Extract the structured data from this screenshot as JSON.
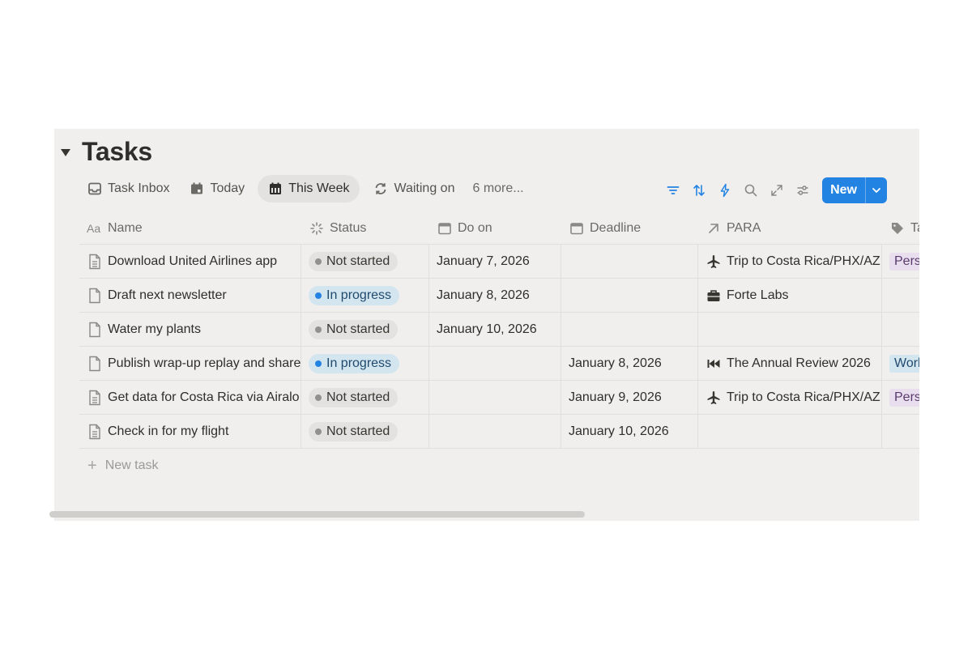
{
  "header": {
    "title": "Tasks"
  },
  "views": [
    {
      "label": "Task Inbox",
      "icon": "inbox-icon",
      "active": false
    },
    {
      "label": "Today",
      "icon": "calendar-day-icon",
      "active": false
    },
    {
      "label": "This Week",
      "icon": "calendar-week-icon",
      "active": true
    },
    {
      "label": "Waiting on",
      "icon": "refresh-icon",
      "active": false
    }
  ],
  "more_views": "6 more...",
  "toolbar": {
    "new_label": "New",
    "accent": "#2383e2"
  },
  "columns": {
    "name": "Name",
    "status": "Status",
    "doon": "Do on",
    "deadline": "Deadline",
    "para": "PARA",
    "tags": "Tags"
  },
  "rows": [
    {
      "name": "Download United Airlines app",
      "status": "Not started",
      "doon": "January 7, 2026",
      "deadline": "",
      "para": "Trip to Costa Rica/PHX/AZ",
      "para_icon": "airplane-icon",
      "tag": "Personal",
      "tag_kind": "personal"
    },
    {
      "name": "Draft next newsletter",
      "status": "In progress",
      "doon": "January 8, 2026",
      "deadline": "",
      "para": "Forte Labs",
      "para_icon": "briefcase-icon",
      "tag": "",
      "tag_kind": ""
    },
    {
      "name": "Water my plants",
      "status": "Not started",
      "doon": "January 10, 2026",
      "deadline": "",
      "para": "",
      "para_icon": "",
      "tag": "",
      "tag_kind": ""
    },
    {
      "name": "Publish wrap-up replay and share",
      "status": "In progress",
      "doon": "",
      "deadline": "January 8, 2026",
      "para": "The Annual Review 2026",
      "para_icon": "rewind-icon",
      "tag": "Work",
      "tag_kind": "work"
    },
    {
      "name": "Get data for Costa Rica via Airalo",
      "status": "Not started",
      "doon": "",
      "deadline": "January 9, 2026",
      "para": "Trip to Costa Rica/PHX/AZ",
      "para_icon": "airplane-icon",
      "tag": "Personal",
      "tag_kind": "personal"
    },
    {
      "name": "Check in for my flight",
      "status": "Not started",
      "doon": "",
      "deadline": "January 10, 2026",
      "para": "",
      "para_icon": "",
      "tag": "",
      "tag_kind": ""
    }
  ],
  "new_task_label": "New task"
}
